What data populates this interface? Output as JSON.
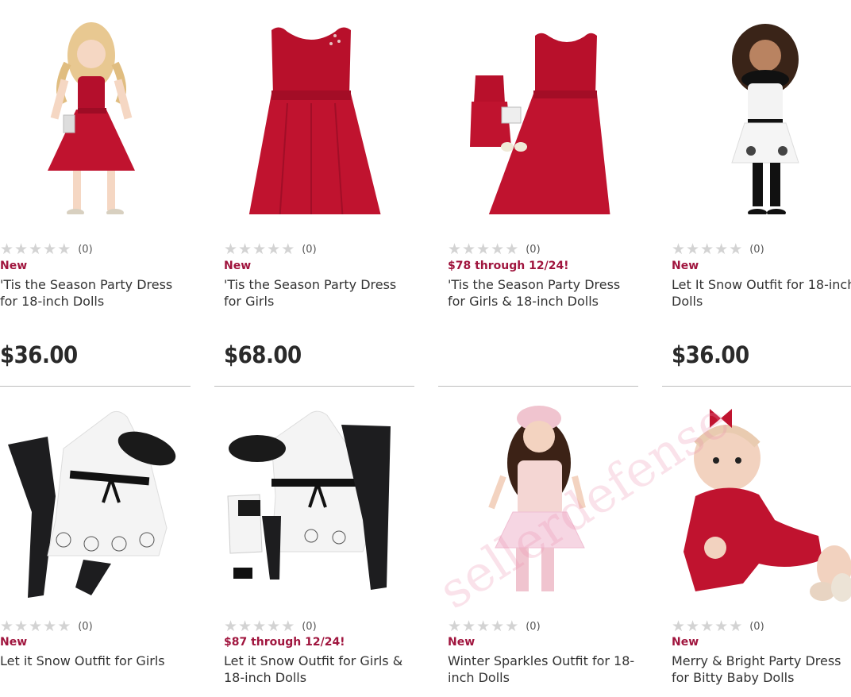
{
  "products": [
    {
      "badge": "New",
      "title": "'Tis the Season Party Dress for 18-inch Dolls",
      "price": "$36.00",
      "rating_count": "(0)",
      "image": "doll-red-dress"
    },
    {
      "badge": "New",
      "title": "'Tis the Season Party Dress for Girls",
      "price": "$68.00",
      "rating_count": "(0)",
      "image": "red-dress"
    },
    {
      "badge": "$78 through 12/24!",
      "title": "'Tis the Season Party Dress for Girls & 18-inch Dolls",
      "price": "",
      "rating_count": "(0)",
      "image": "red-dress-set"
    },
    {
      "badge": "New",
      "title": "Let It Snow Outfit for 18-inch Dolls",
      "price": "$36.00",
      "rating_count": "(0)",
      "image": "doll-snow-outfit"
    },
    {
      "badge": "New",
      "title": "Let it Snow Outfit for Girls",
      "price": "",
      "rating_count": "(0)",
      "image": "snow-outfit"
    },
    {
      "badge": "$87 through 12/24!",
      "title": "Let it Snow Outfit for Girls & 18-inch Dolls",
      "price": "",
      "rating_count": "(0)",
      "image": "snow-outfit-set"
    },
    {
      "badge": "New",
      "title": "Winter Sparkles Outfit for 18-inch Dolls",
      "price": "",
      "rating_count": "(0)",
      "image": "doll-pink-outfit"
    },
    {
      "badge": "New",
      "title": "Merry & Bright Party Dress for Bitty Baby Dolls",
      "price": "",
      "rating_count": "(0)",
      "image": "baby-doll-red-dress"
    }
  ],
  "stars_per_rating": 5,
  "watermark": "sellerdefense",
  "colors": {
    "badge": "#a0153e",
    "dress_red": "#c0132f",
    "star_empty": "#d3d3d3"
  }
}
